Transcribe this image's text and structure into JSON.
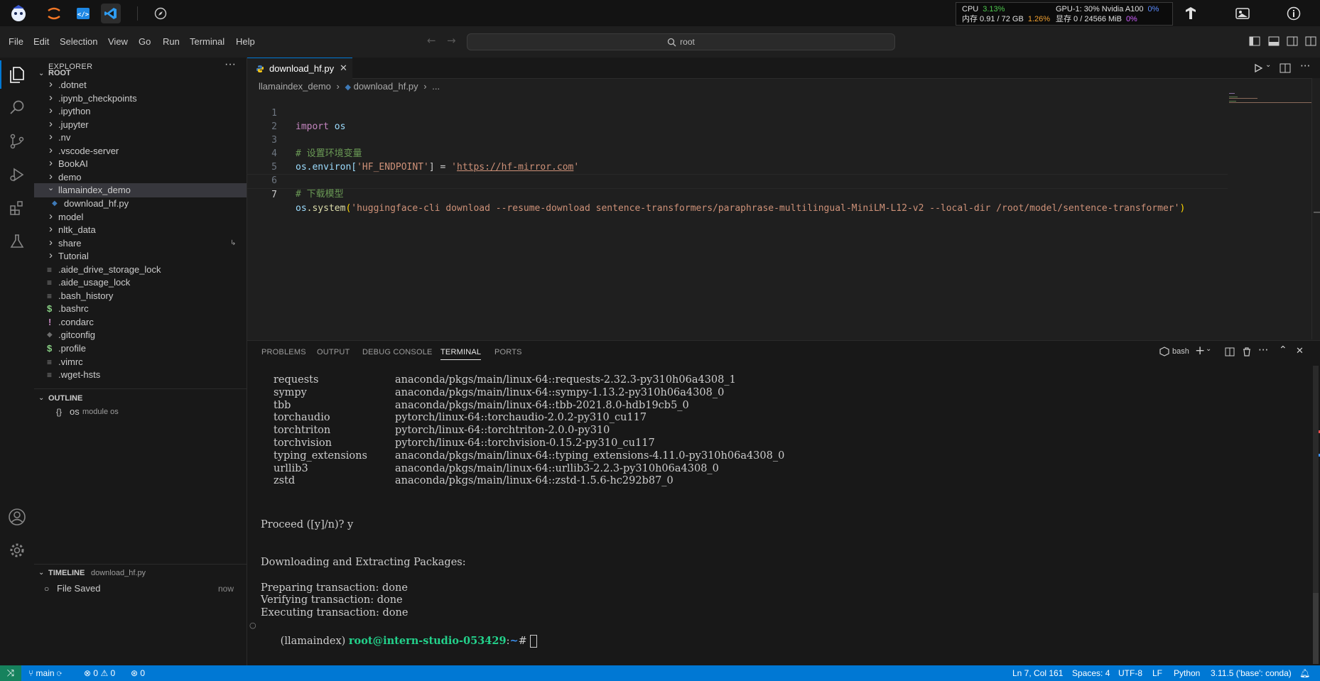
{
  "system": {
    "perf": {
      "cpu_label": "CPU",
      "cpu_value": "3.13%",
      "mem_label": "内存 0.91 / 72 GB",
      "mem_value": "1.26%",
      "gpu_label": "GPU-1: 30% Nvidia A100",
      "gpu_value": "0%",
      "vram_label": "显存 0 / 24566 MiB",
      "vram_value": "0%"
    }
  },
  "menu": {
    "items": [
      "File",
      "Edit",
      "Selection",
      "View",
      "Go",
      "Run",
      "Terminal",
      "Help"
    ],
    "search_text": "root"
  },
  "explorer": {
    "title": "EXPLORER",
    "root_label": "ROOT",
    "items": [
      {
        "label": ".dotnet",
        "type": "folder"
      },
      {
        "label": ".ipynb_checkpoints",
        "type": "folder"
      },
      {
        "label": ".ipython",
        "type": "folder"
      },
      {
        "label": ".jupyter",
        "type": "folder"
      },
      {
        "label": ".nv",
        "type": "folder"
      },
      {
        "label": ".vscode-server",
        "type": "folder"
      },
      {
        "label": "BookAI",
        "type": "folder"
      },
      {
        "label": "demo",
        "type": "folder"
      },
      {
        "label": "llamaindex_demo",
        "type": "folder-open"
      },
      {
        "label": "download_hf.py",
        "type": "python"
      },
      {
        "label": "model",
        "type": "folder"
      },
      {
        "label": "nltk_data",
        "type": "folder"
      },
      {
        "label": "share",
        "type": "folder"
      },
      {
        "label": "Tutorial",
        "type": "folder"
      },
      {
        "label": ".aide_drive_storage_lock",
        "type": "file"
      },
      {
        "label": ".aide_usage_lock",
        "type": "file"
      },
      {
        "label": ".bash_history",
        "type": "file"
      },
      {
        "label": ".bashrc",
        "type": "dollar"
      },
      {
        "label": ".condarc",
        "type": "excl"
      },
      {
        "label": ".gitconfig",
        "type": "git"
      },
      {
        "label": ".profile",
        "type": "dollar"
      },
      {
        "label": ".vimrc",
        "type": "file"
      },
      {
        "label": ".wget-hsts",
        "type": "file"
      }
    ],
    "outline_title": "OUTLINE",
    "outline_item": "os",
    "outline_item_detail": "module os",
    "timeline_title": "TIMELINE",
    "timeline_file": "download_hf.py",
    "timeline_entry": "File Saved",
    "timeline_time": "now"
  },
  "editor": {
    "tab_label": "download_hf.py",
    "breadcrumb": [
      "llamaindex_demo",
      "download_hf.py",
      "..."
    ],
    "line_numbers": [
      "1",
      "2",
      "3",
      "4",
      "5",
      "6",
      "7"
    ],
    "code": {
      "l1_kw": "import",
      "l1_mod": "os",
      "l3": "# 设置环境变量",
      "l4_obj": "os",
      "l4_attr": ".environ[",
      "l4_key": "'HF_ENDPOINT'",
      "l4_eq": "] = ",
      "l4_val_pre": "'",
      "l4_url": "https://hf-mirror.com",
      "l4_val_post": "'",
      "l6": "# 下载模型",
      "l7_obj": "os",
      "l7_fn": ".system",
      "l7_open": "(",
      "l7_str": "'huggingface-cli download --resume-download sentence-transformers/paraphrase-multilingual-MiniLM-L12-v2 --local-dir /root/model/sentence-transformer'",
      "l7_close": ")"
    }
  },
  "panel": {
    "tabs": [
      "PROBLEMS",
      "OUTPUT",
      "DEBUG CONSOLE",
      "TERMINAL",
      "PORTS"
    ],
    "shell_label": "bash",
    "packages": [
      {
        "name": "requests",
        "source": "anaconda/pkgs/main/linux-64::requests-2.32.3-py310h06a4308_1"
      },
      {
        "name": "sympy",
        "source": "anaconda/pkgs/main/linux-64::sympy-1.13.2-py310h06a4308_0"
      },
      {
        "name": "tbb",
        "source": "anaconda/pkgs/main/linux-64::tbb-2021.8.0-hdb19cb5_0"
      },
      {
        "name": "torchaudio",
        "source": "pytorch/linux-64::torchaudio-2.0.2-py310_cu117"
      },
      {
        "name": "torchtriton",
        "source": "pytorch/linux-64::torchtriton-2.0.0-py310"
      },
      {
        "name": "torchvision",
        "source": "pytorch/linux-64::torchvision-0.15.2-py310_cu117"
      },
      {
        "name": "typing_extensions",
        "source": "anaconda/pkgs/main/linux-64::typing_extensions-4.11.0-py310h06a4308_0"
      },
      {
        "name": "urllib3",
        "source": "anaconda/pkgs/main/linux-64::urllib3-2.2.3-py310h06a4308_0"
      },
      {
        "name": "zstd",
        "source": "anaconda/pkgs/main/linux-64::zstd-1.5.6-hc292b87_0"
      }
    ],
    "proceed": "Proceed ([y]/n)? y",
    "downloading": "Downloading and Extracting Packages:",
    "prep": "Preparing transaction: done",
    "verify": "Verifying transaction: done",
    "exec": "Executing transaction: done",
    "prompt_env": "(llamaindex) ",
    "prompt_user": "root@intern-studio-053429",
    "prompt_sep": ":",
    "prompt_path": "~",
    "prompt_end": "# "
  },
  "status": {
    "branch": "main",
    "errors": "0",
    "warnings": "0",
    "ports": "0",
    "position": "Ln 7, Col 161",
    "spaces": "Spaces: 4",
    "encoding": "UTF-8",
    "eol": "LF",
    "language": "Python",
    "interpreter": "3.11.5 ('base': conda)"
  },
  "colors": {
    "accent": "#0078d4",
    "status_bg": "#0078d4",
    "cpu_green": "#4ec94e",
    "mem_orange": "#f0a030",
    "gpu_blue": "#5b8cff",
    "vram_pink": "#d060ff"
  }
}
